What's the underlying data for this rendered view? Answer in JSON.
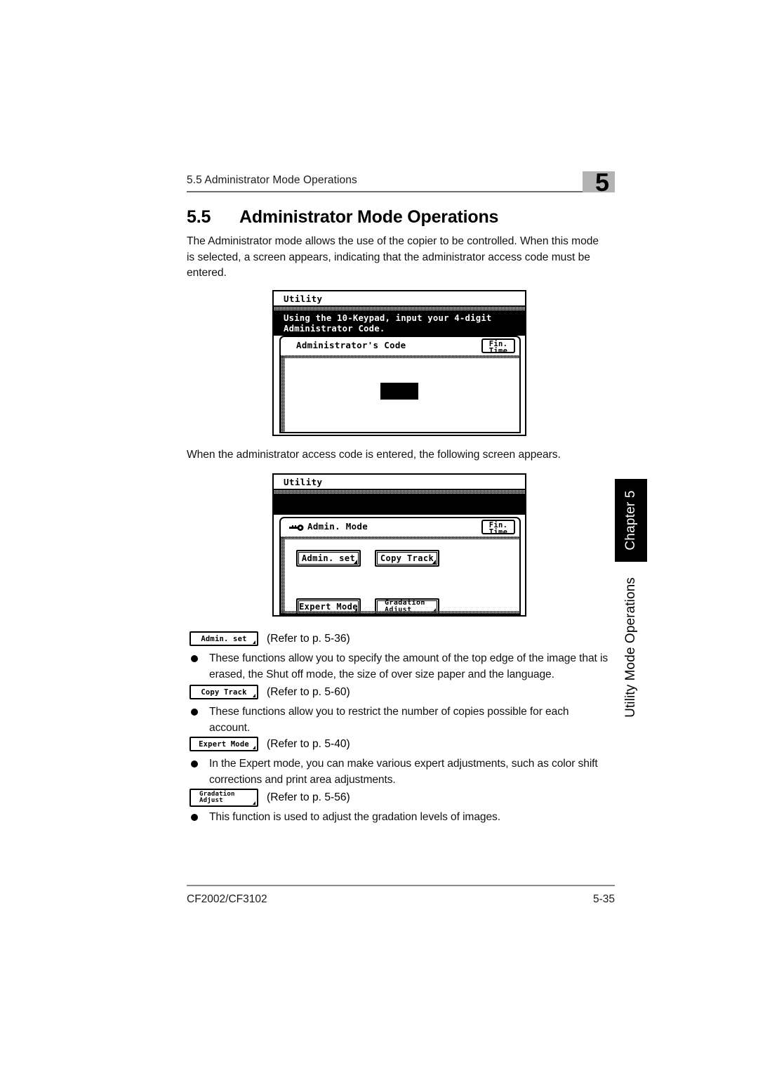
{
  "header": {
    "running_head": "5.5 Administrator Mode Operations",
    "chapter_marker": "5"
  },
  "section": {
    "number": "5.5",
    "title": "Administrator Mode Operations"
  },
  "paragraphs": {
    "intro": "The Administrator mode allows the use of the copier to be controlled. When this mode is selected, a screen appears, indicating that the administrator access code must be entered.",
    "second": "When the administrator access code is entered, the following screen appears."
  },
  "lcd_code_screen": {
    "window_title": "Utility",
    "message_line1": "Using the 10-Keypad, input your 4-digit",
    "message_line2": "Administrator Code.",
    "panel_title": "Administrator's Code",
    "fin_button": {
      "line1": "Fin.",
      "line2": "Time"
    }
  },
  "lcd_admin_screen": {
    "window_title": "Utility",
    "panel_title": "Admin. Mode",
    "panel_icon": "key-icon",
    "fin_button": {
      "line1": "Fin.",
      "line2": "Time"
    },
    "buttons": [
      {
        "label": "Admin. set"
      },
      {
        "label": "Copy Track"
      },
      {
        "label": "Expert Mode"
      },
      {
        "label": "Gradation\nAdjust"
      }
    ]
  },
  "references": [
    {
      "button_label": "Admin. set",
      "ref_text": "(Refer to p. 5-36)",
      "bullet": "These functions allow you to specify the amount of the top edge of the image that is erased, the Shut off mode, the size of over size paper and the language."
    },
    {
      "button_label": "Copy Track",
      "ref_text": "(Refer to p. 5-60)",
      "bullet": "These functions allow you to restrict the number of copies possible for each account."
    },
    {
      "button_label": "Expert Mode",
      "ref_text": "(Refer to p. 5-40)",
      "bullet": "In the Expert mode, you can make various expert adjustments, such as color shift corrections and print area adjustments."
    },
    {
      "button_label": "Gradation\nAdjust",
      "ref_text": "(Refer to p. 5-56)",
      "bullet": "This function is used to adjust the gradation levels of images."
    }
  ],
  "side_tab": {
    "chapter_label": "Chapter 5",
    "caption": "Utility Mode Operations"
  },
  "footer": {
    "model": "CF2002/CF3102",
    "page_number": "5-35"
  }
}
